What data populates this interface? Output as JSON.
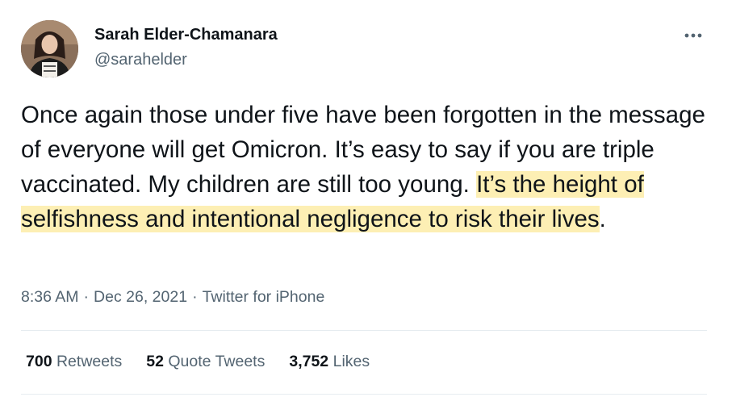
{
  "author": {
    "name": "Sarah Elder-Chamanara",
    "handle": "@sarahelder"
  },
  "tweet": {
    "text_plain": "Once again those under five have been forgotten in the message of everyone will get Omicron. It’s easy to say if you are triple vaccinated. My children are still too young. ",
    "text_highlighted": "It’s the height of selfishness and intentional negligence to risk their lives",
    "text_trailing": ".",
    "highlight_color": "#fdefb4"
  },
  "meta": {
    "time": "8:36 AM",
    "separator": "·",
    "date": "Dec 26, 2021",
    "source": "Twitter for iPhone"
  },
  "stats": {
    "retweets_count": "700",
    "retweets_label": "Retweets",
    "quotes_count": "52",
    "quotes_label": "Quote Tweets",
    "likes_count": "3,752",
    "likes_label": "Likes"
  },
  "icons": {
    "more": "more-horizontal-icon"
  },
  "colors": {
    "text_primary": "#0f1419",
    "text_secondary": "#536471",
    "divider": "#e6ecf0"
  }
}
